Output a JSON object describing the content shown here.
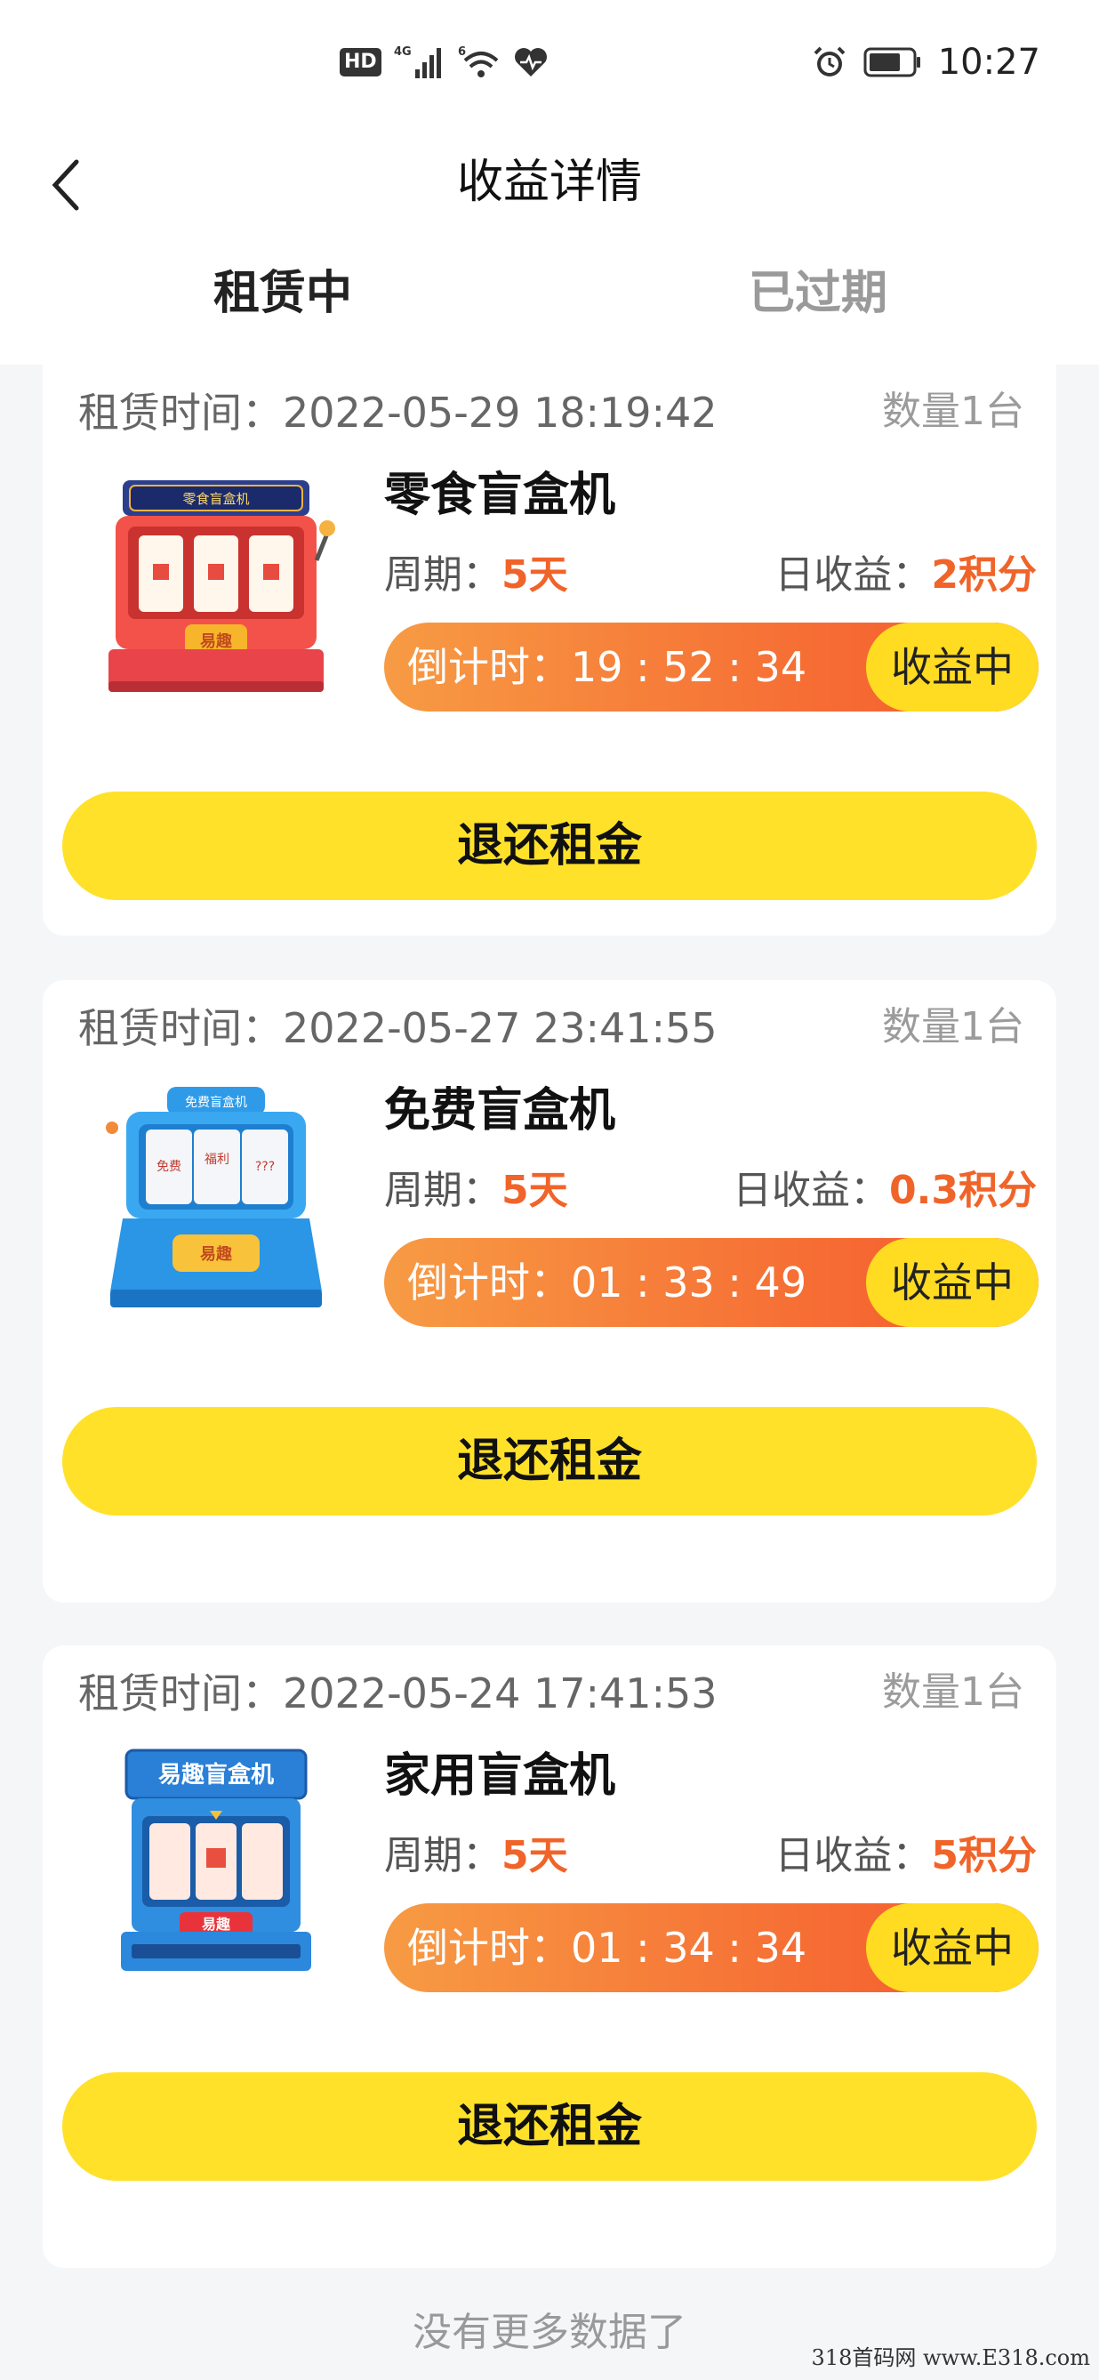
{
  "status_bar": {
    "hd_badge": "HD",
    "network": "4G",
    "wifi_tag": "6",
    "time": "10:27",
    "icons": [
      "signal-icon",
      "wifi-icon",
      "heart-rate-icon",
      "alarm-icon",
      "battery-icon"
    ]
  },
  "header": {
    "title": "收益详情",
    "back_icon": "chevron-left-icon"
  },
  "tabs": [
    {
      "label": "租赁中",
      "active": true
    },
    {
      "label": "已过期",
      "active": false
    }
  ],
  "colors": {
    "accent_yellow": "#ffe12a",
    "accent_orange": "#f0642a",
    "countdown_gradient": [
      "#f79b44",
      "#f25a2c"
    ]
  },
  "rentals": [
    {
      "rent_time_label": "租赁时间：",
      "rent_time": "2022-05-29 18:19:42",
      "quantity": "数量1台",
      "product_name": "零食盲盒机",
      "machine_image": "snack-blind-box-machine-icon",
      "cycle_label": "周期：",
      "cycle_value": "5天",
      "daily_label": "日收益：",
      "daily_value": "2积分",
      "countdown_label": "倒计时：",
      "countdown_value": "19 : 52 : 34",
      "status": "收益中",
      "refund_button": "退还租金"
    },
    {
      "rent_time_label": "租赁时间：",
      "rent_time": "2022-05-27 23:41:55",
      "quantity": "数量1台",
      "product_name": "免费盲盒机",
      "machine_image": "free-blind-box-machine-icon",
      "cycle_label": "周期：",
      "cycle_value": "5天",
      "daily_label": "日收益：",
      "daily_value": "0.3积分",
      "countdown_label": "倒计时：",
      "countdown_value": "01 : 33 : 49",
      "status": "收益中",
      "refund_button": "退还租金"
    },
    {
      "rent_time_label": "租赁时间：",
      "rent_time": "2022-05-24 17:41:53",
      "quantity": "数量1台",
      "product_name": "家用盲盒机",
      "machine_image": "home-blind-box-machine-icon",
      "cycle_label": "周期：",
      "cycle_value": "5天",
      "daily_label": "日收益：",
      "daily_value": "5积分",
      "countdown_label": "倒计时：",
      "countdown_value": "01 : 34 : 34",
      "status": "收益中",
      "refund_button": "退还租金"
    }
  ],
  "machine_logos": {
    "snack_sign": "零食盲盒机",
    "snack_button": "易趣",
    "free_sign": "免费盲盒机",
    "free_button": "易趣",
    "free_reel_1": "免费",
    "free_reel_2": "福利",
    "free_reel_3": "???",
    "home_sign": "易趣盲盒机",
    "home_button": "易趣"
  },
  "footer": {
    "no_more": "没有更多数据了",
    "watermark": "318首码网 www.E318.com"
  }
}
